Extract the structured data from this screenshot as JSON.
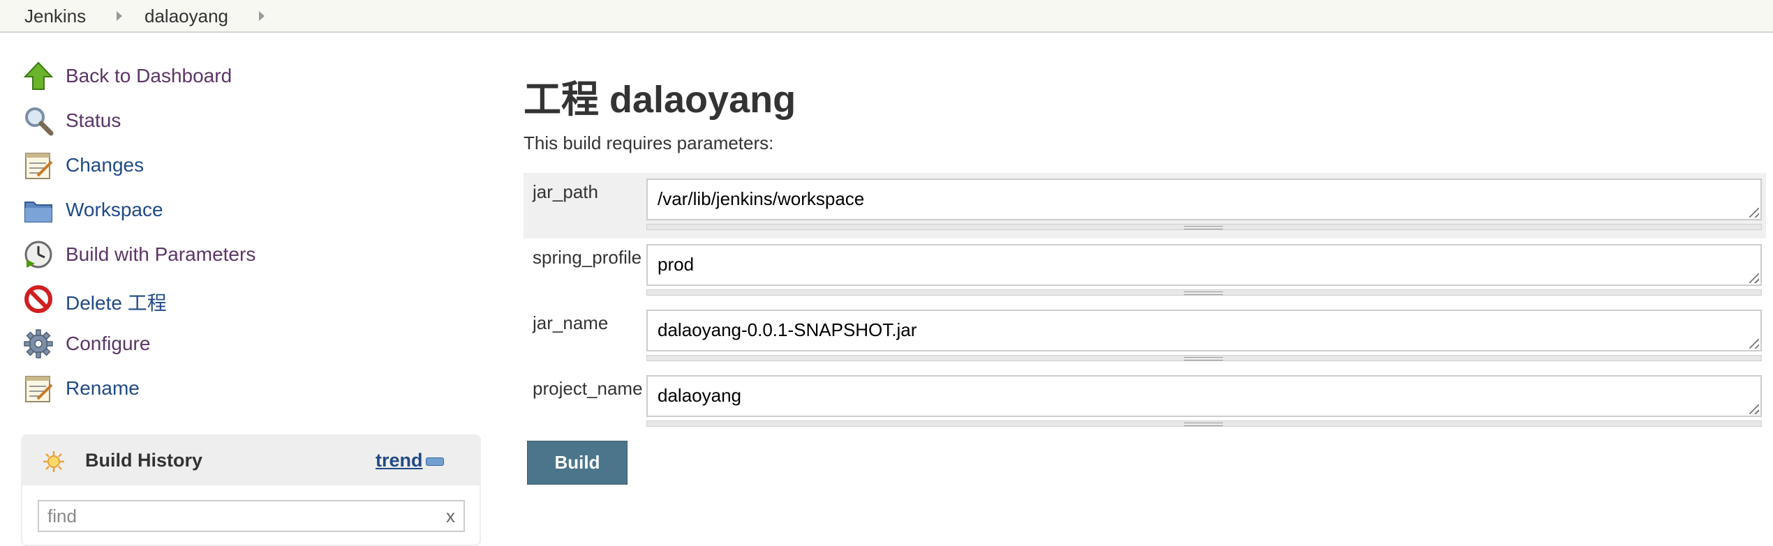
{
  "breadcrumb": {
    "items": [
      {
        "label": "Jenkins"
      },
      {
        "label": "dalaoyang"
      }
    ]
  },
  "sidebar": {
    "items": [
      {
        "label": "Back to Dashboard",
        "icon": "up-arrow-icon"
      },
      {
        "label": "Status",
        "icon": "magnifier-icon"
      },
      {
        "label": "Changes",
        "icon": "notepad-icon"
      },
      {
        "label": "Workspace",
        "icon": "folder-icon"
      },
      {
        "label": "Build with Parameters",
        "icon": "clock-build-icon"
      },
      {
        "label": "Delete 工程",
        "icon": "no-entry-icon"
      },
      {
        "label": "Configure",
        "icon": "gear-icon"
      },
      {
        "label": "Rename",
        "icon": "notepad-icon"
      }
    ]
  },
  "build_history": {
    "title": "Build History",
    "trend_label": "trend",
    "search_placeholder": "find",
    "clear_label": "x"
  },
  "main": {
    "title": "工程 dalaoyang",
    "intro": "This build requires parameters:",
    "parameters": [
      {
        "name": "jar_path",
        "value": "/var/lib/jenkins/workspace"
      },
      {
        "name": "spring_profile",
        "value": "prod"
      },
      {
        "name": "jar_name",
        "value": "dalaoyang-0.0.1-SNAPSHOT.jar"
      },
      {
        "name": "project_name",
        "value": "dalaoyang"
      }
    ],
    "build_button": "Build"
  },
  "colors": {
    "breadcrumb_bg": "#f6f8f1",
    "visited_link": "#5c3566",
    "link": "#204a87",
    "build_button_bg": "#4b758b",
    "highlight_row_bg": "#f0f0f0"
  }
}
